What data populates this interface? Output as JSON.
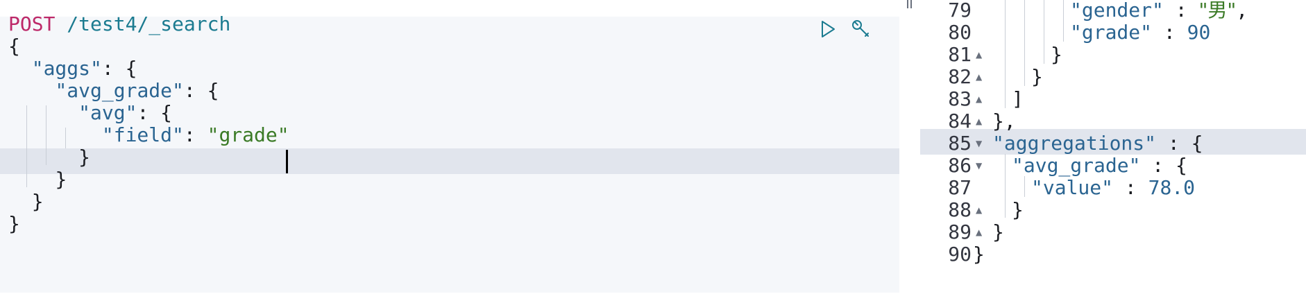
{
  "request": {
    "method": "POST",
    "path": "/test4/_search",
    "lines": {
      "open": "{",
      "aggs_key": "\"aggs\"",
      "avg_grade_key": "\"avg_grade\"",
      "avg_key": "\"avg\"",
      "field_key": "\"field\"",
      "field_value": "\"grade\""
    },
    "actions": {
      "run_icon": "play-icon",
      "settings_icon": "wrench-icon"
    }
  },
  "response": {
    "line_numbers": [
      "79",
      "80",
      "81",
      "82",
      "83",
      "84",
      "85",
      "86",
      "87",
      "88",
      "89",
      "90"
    ],
    "gender_key": "\"gender\"",
    "gender_value": "\"男\"",
    "grade_key": "\"grade\"",
    "grade_value": "90",
    "aggregations_key": "\"aggregations\"",
    "avg_grade_key": "\"avg_grade\"",
    "value_key": "\"value\"",
    "value_value": "78.0"
  },
  "colors": {
    "method": "#bd2868",
    "url": "#1b7b90",
    "key": "#2a6491",
    "string": "#3a7a25",
    "active_line": "#e1e5ed",
    "editor_bg": "#f5f7fa"
  }
}
